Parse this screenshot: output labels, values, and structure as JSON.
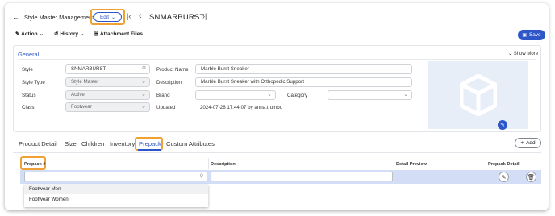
{
  "header": {
    "title": "Style Master Management",
    "edit_label": "Edit",
    "record_name": "SNMARBURST",
    "save_label": "Save"
  },
  "toolbar": {
    "action_label": "Action",
    "history_label": "History",
    "attachment_label": "Attachment Files"
  },
  "section": {
    "title": "General",
    "show_more": "Show More"
  },
  "form": {
    "style_label": "Style",
    "style_value": "SNMARBURST",
    "style_type_label": "Style Type",
    "style_type_value": "Style Master",
    "status_label": "Status",
    "status_value": "Active",
    "class_label": "Class",
    "class_value": "Footwear",
    "product_name_label": "Product Name",
    "product_name_value": "Marble Burst Sneaker",
    "description_label": "Description",
    "description_value": "Marble Burst Sneaker with Orthopedic Support",
    "brand_label": "Brand",
    "brand_value": "",
    "category_label": "Category",
    "category_value": "",
    "updated_label": "Updated",
    "updated_value": "2024-07-26 17:44:07 by anna.trumbo"
  },
  "tabs": [
    "Product Detail",
    "Size",
    "Children",
    "Inventory",
    "Prepack",
    "Custom Attributes"
  ],
  "add_label": "Add",
  "table": {
    "columns": [
      "Prepack #",
      "Description",
      "Detail Preview",
      "Prepack Detail"
    ]
  },
  "dropdown": {
    "options": [
      "Footwear Men",
      "Footwear Women"
    ]
  },
  "colors": {
    "primary": "#2d56c9",
    "highlight": "#f0a134",
    "image_bg": "#e7eef8",
    "row_bg": "#d3def6"
  }
}
